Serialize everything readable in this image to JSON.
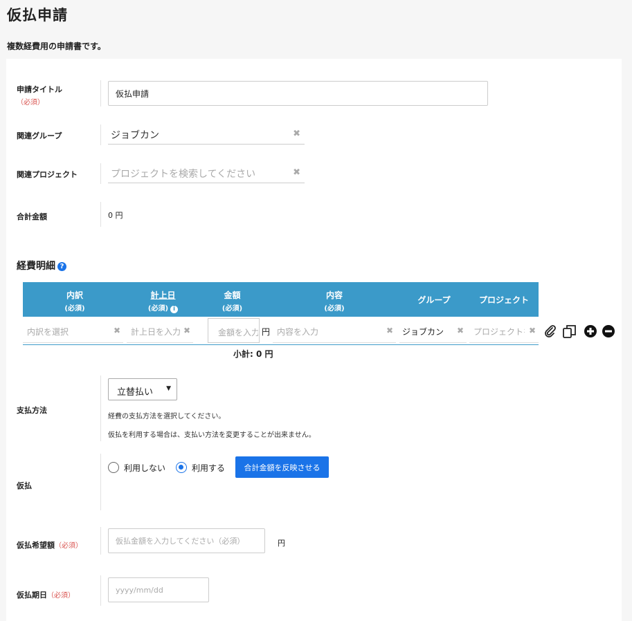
{
  "page": {
    "title": "仮払申請",
    "description": "複数経費用の申請書です。"
  },
  "form": {
    "title_field": {
      "label": "申請タイトル",
      "required": "（必須）",
      "value": "仮払申請"
    },
    "group_field": {
      "label": "関連グループ",
      "value": "ジョブカン"
    },
    "project_field": {
      "label": "関連プロジェクト",
      "placeholder": "プロジェクトを検索してください"
    },
    "total_field": {
      "label": "合計金額",
      "value": "0 円"
    }
  },
  "expense": {
    "section_title": "経費明細",
    "headers": [
      {
        "label": "内訳",
        "sub": "(必須)"
      },
      {
        "label": "計上日",
        "sub": "(必須)"
      },
      {
        "label": "金額",
        "sub": "(必須)"
      },
      {
        "label": "内容",
        "sub": "(必須)"
      },
      {
        "label": "グループ",
        "sub": ""
      },
      {
        "label": "プロジェクト",
        "sub": ""
      }
    ],
    "row": {
      "breakdown_placeholder": "内訳を選択",
      "date_placeholder": "計上日を入力",
      "amount_placeholder": "金額を入力",
      "amount_unit": "円",
      "content_placeholder": "内容を入力",
      "group_value": "ジョブカン",
      "project_placeholder": "プロジェクトを"
    },
    "subtotal": "小計: 0 円",
    "icons": [
      "paperclip-icon",
      "copy-icon",
      "plus-circle-icon",
      "minus-circle-icon"
    ]
  },
  "payment": {
    "label": "支払方法",
    "selected": "立替払い",
    "note1": "経費の支払方法を選択してください。",
    "note2": "仮払を利用する場合は、支払い方法を変更することが出来ません。"
  },
  "advance": {
    "label": "仮払",
    "option_no": "利用しない",
    "option_yes": "利用する",
    "selected": "利用する",
    "reflect_button": "合計金額を反映させる"
  },
  "advance_amount": {
    "label": "仮払希望額",
    "required": "（必須）",
    "placeholder": "仮払金額を入力してください（必須）",
    "unit": "円"
  },
  "advance_date": {
    "label": "仮払期日",
    "required": "（必須）",
    "placeholder": "yyyy/mm/dd"
  },
  "colors": {
    "accent": "#1a73e8",
    "table_header": "#3b9ac9",
    "required": "#d9534f"
  }
}
